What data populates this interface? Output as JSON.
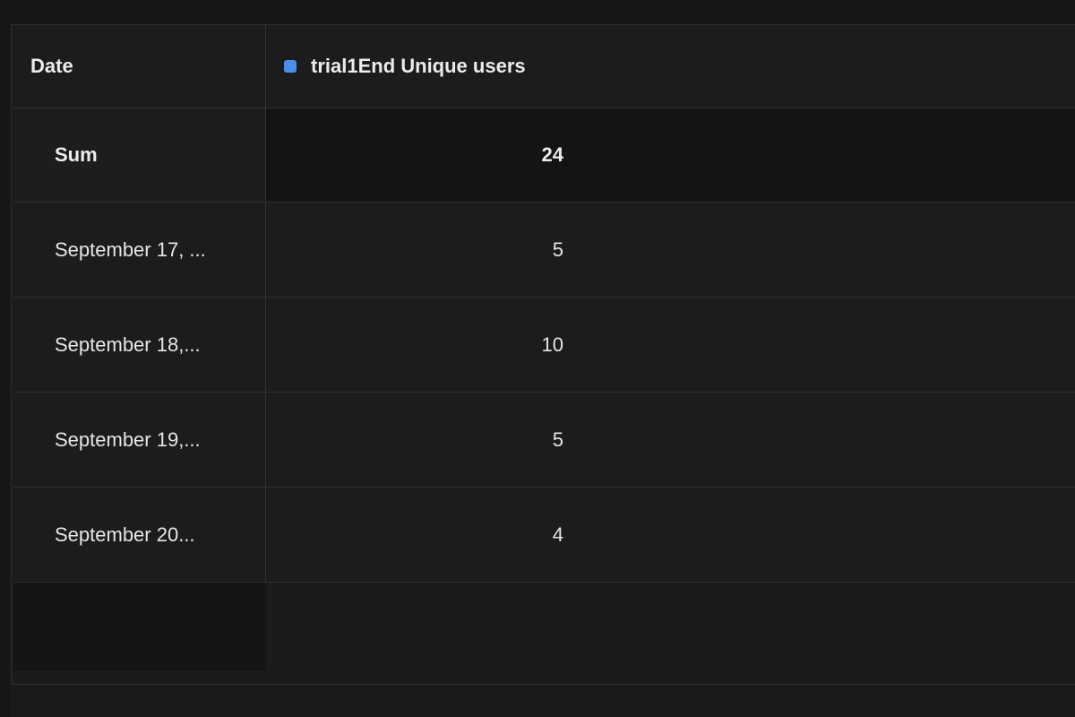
{
  "table": {
    "columns": {
      "date": "Date",
      "series": "trial1End Unique users"
    },
    "series_color": "#4a8fe7",
    "sum": {
      "label": "Sum",
      "value": "24"
    },
    "rows": [
      {
        "date": "September 17, ...",
        "value": "5"
      },
      {
        "date": "September 18,...",
        "value": "10"
      },
      {
        "date": "September 19,...",
        "value": "5"
      },
      {
        "date": "September 20...",
        "value": "4"
      }
    ]
  }
}
